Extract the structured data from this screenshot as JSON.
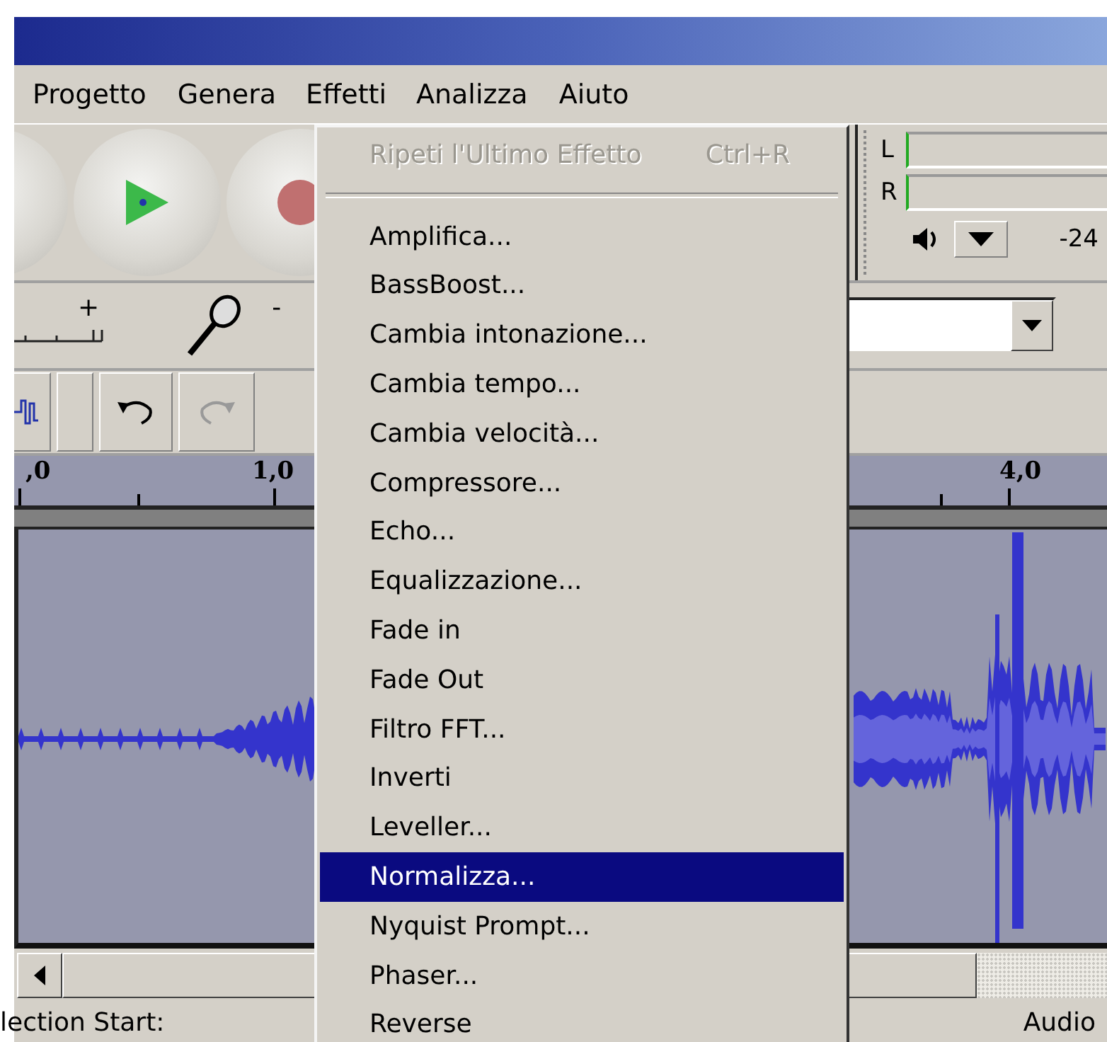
{
  "menubar": {
    "items": [
      {
        "label": "Progetto",
        "selected": false
      },
      {
        "label": "Genera",
        "selected": false
      },
      {
        "label": "Effetti",
        "selected": true
      },
      {
        "label": "Analizza",
        "selected": false
      },
      {
        "label": "Aiuto",
        "selected": false
      }
    ]
  },
  "effects_menu": {
    "items": [
      {
        "kind": "item",
        "label": "Ripeti l'Ultimo Effetto",
        "shortcut": "Ctrl+R",
        "disabled": true,
        "selected": false
      },
      {
        "kind": "separator"
      },
      {
        "kind": "item",
        "label": "Amplifica...",
        "disabled": false,
        "selected": false
      },
      {
        "kind": "item",
        "label": "BassBoost...",
        "disabled": false,
        "selected": false
      },
      {
        "kind": "item",
        "label": "Cambia intonazione...",
        "disabled": false,
        "selected": false
      },
      {
        "kind": "item",
        "label": "Cambia tempo...",
        "disabled": false,
        "selected": false
      },
      {
        "kind": "item",
        "label": "Cambia velocità...",
        "disabled": false,
        "selected": false
      },
      {
        "kind": "item",
        "label": "Compressore...",
        "disabled": false,
        "selected": false
      },
      {
        "kind": "item",
        "label": "Echo...",
        "disabled": false,
        "selected": false
      },
      {
        "kind": "item",
        "label": "Equalizzazione...",
        "disabled": false,
        "selected": false
      },
      {
        "kind": "item",
        "label": "Fade in",
        "disabled": false,
        "selected": false
      },
      {
        "kind": "item",
        "label": "Fade Out",
        "disabled": false,
        "selected": false
      },
      {
        "kind": "item",
        "label": "Filtro FFT...",
        "disabled": false,
        "selected": false
      },
      {
        "kind": "item",
        "label": "Inverti",
        "disabled": false,
        "selected": false
      },
      {
        "kind": "item",
        "label": "Leveller...",
        "disabled": false,
        "selected": false
      },
      {
        "kind": "item",
        "label": "Normalizza...",
        "disabled": false,
        "selected": true
      },
      {
        "kind": "item",
        "label": "Nyquist Prompt...",
        "disabled": false,
        "selected": false
      },
      {
        "kind": "item",
        "label": "Phaser...",
        "disabled": false,
        "selected": false
      },
      {
        "kind": "item",
        "label": "Reverse",
        "disabled": false,
        "selected": false
      }
    ]
  },
  "mixer": {
    "plus": "+",
    "minus": "-"
  },
  "meter": {
    "channels": [
      "L",
      "R"
    ],
    "scale": "-24"
  },
  "ruler": {
    "labels": [
      ",0",
      "1,0",
      "4,0"
    ]
  },
  "status_bar": {
    "left": "lection Start:",
    "right": "Audio"
  }
}
